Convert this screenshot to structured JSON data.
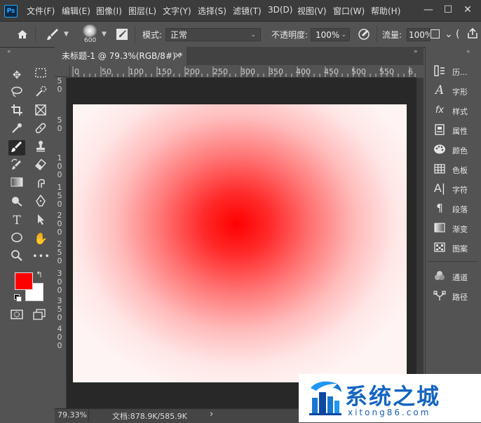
{
  "menubar": {
    "logo": "Ps",
    "items": [
      "文件(F)",
      "编辑(E)",
      "图像(I)",
      "图层(L)",
      "文字(Y)",
      "选择(S)",
      "滤镜(T)",
      "3D(D)",
      "视图(V)",
      "窗口(W)",
      "帮助(H)"
    ],
    "minimize": "—",
    "maximize": "☐",
    "close": "✕"
  },
  "options": {
    "brush_size": "600",
    "mode_label": "模式:",
    "mode_value": "正常",
    "opacity_label": "不透明度:",
    "opacity_value": "100%",
    "flow_label": "流量:",
    "flow_value": "100%"
  },
  "document": {
    "tab_title": "未标题-1 @ 79.3%(RGB/8#) *",
    "tab_close": "×",
    "ruler_h": [
      "0",
      "50",
      "100",
      "150",
      "200",
      "250",
      "300",
      "350",
      "400",
      "450",
      "500",
      "550",
      "6"
    ],
    "ruler_v": [
      "5",
      "0",
      "5",
      "0",
      "1",
      "0",
      "0",
      "1",
      "5",
      "0",
      "2",
      "0",
      "0",
      "2",
      "5",
      "0",
      "3",
      "0",
      "0",
      "3",
      "5",
      "0",
      "4",
      "0",
      "0"
    ],
    "canvas": {
      "center_color": "#ff0000",
      "edge_color": "#fff4f4"
    }
  },
  "status": {
    "zoom": "79.33%",
    "doc_info": "文档:878.9K/585.9K",
    "arrow": "›"
  },
  "colors": {
    "foreground": "#ff0000",
    "background": "#ffffff",
    "swap": "↰"
  },
  "panels": [
    {
      "label": "历...",
      "icon": "history-icon"
    },
    {
      "label": "字形",
      "icon": "glyphs-icon"
    },
    {
      "label": "样式",
      "icon": "styles-icon"
    },
    {
      "label": "属性",
      "icon": "properties-icon"
    },
    {
      "label": "颜色",
      "icon": "color-icon"
    },
    {
      "label": "色板",
      "icon": "swatches-icon"
    },
    {
      "label": "字符",
      "icon": "character-icon"
    },
    {
      "label": "段落",
      "icon": "paragraph-icon"
    },
    {
      "label": "渐变",
      "icon": "gradient-icon"
    },
    {
      "label": "图案",
      "icon": "patterns-icon"
    },
    {
      "label": "通道",
      "icon": "channels-icon"
    },
    {
      "label": "路径",
      "icon": "paths-icon"
    }
  ],
  "watermark": {
    "title": "系统之城",
    "sub": "xitong86.com"
  }
}
